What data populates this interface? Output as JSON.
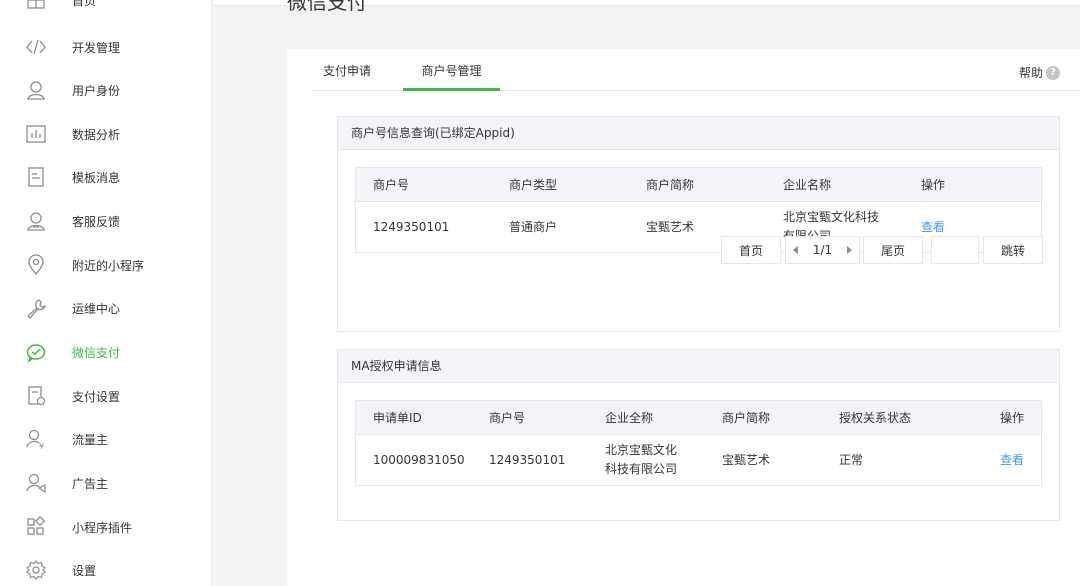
{
  "page_title": "微信支付",
  "sidebar": {
    "items": [
      {
        "label": "首页",
        "icon": "grid-icon"
      },
      {
        "label": "开发管理",
        "icon": "code-icon"
      },
      {
        "label": "用户身份",
        "icon": "user-icon"
      },
      {
        "label": "数据分析",
        "icon": "bar-chart-icon"
      },
      {
        "label": "模板消息",
        "icon": "document-icon"
      },
      {
        "label": "客服反馈",
        "icon": "customer-service-icon"
      },
      {
        "label": "附近的小程序",
        "icon": "location-pin-icon"
      },
      {
        "label": "运维中心",
        "icon": "wrench-icon"
      },
      {
        "label": "微信支付",
        "icon": "wechat-pay-icon",
        "active": true
      },
      {
        "label": "支付设置",
        "icon": "payment-settings-icon"
      },
      {
        "label": "流量主",
        "icon": "traffic-owner-icon"
      },
      {
        "label": "广告主",
        "icon": "advertiser-icon"
      },
      {
        "label": "小程序插件",
        "icon": "plugin-icon"
      },
      {
        "label": "设置",
        "icon": "gear-icon"
      }
    ],
    "active_color": "#44b549"
  },
  "tabs": [
    {
      "label": "支付申请"
    },
    {
      "label": "商户号管理",
      "active": true
    }
  ],
  "help_label": "帮助",
  "help_icon_text": "?",
  "merchant_section": {
    "title": "商户号信息查询(已绑定Appid)",
    "columns": [
      "商户号",
      "商户类型",
      "商户简称",
      "企业名称",
      "操作"
    ],
    "rows": [
      {
        "merchant_id": "1249350101",
        "merchant_type": "普通商户",
        "short_name": "宝甄艺术",
        "company_line1": "北京宝甄文化科技",
        "company_line2": "有限公司",
        "action": "查看"
      }
    ],
    "pager": {
      "first": "首页",
      "page": "1/1",
      "last": "尾页",
      "jump": "跳转"
    }
  },
  "ma_section": {
    "title": "MA授权申请信息",
    "columns": [
      "申请单ID",
      "商户号",
      "企业全称",
      "商户简称",
      "授权关系状态",
      "操作"
    ],
    "rows": [
      {
        "apply_id": "100009831050",
        "merchant_id": "1249350101",
        "company_line1": "北京宝甄文化",
        "company_line2": "科技有限公司",
        "short_name": "宝甄艺术",
        "status": "正常",
        "action": "查看"
      }
    ]
  },
  "link_color": "#459ae9"
}
